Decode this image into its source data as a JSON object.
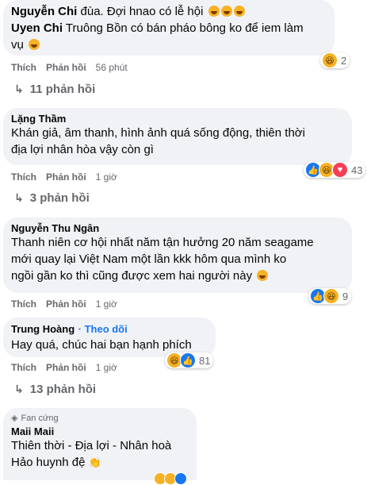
{
  "comments": [
    {
      "author": "Nguyễn Chi",
      "text": "đùa. Đợi hnao có lễ hội",
      "reply_author": "Uyen Chi",
      "reply_text_line1": "Truông Bồn có bán pháo bông ko để iem làm",
      "reply_text_line2": "vụ",
      "actions": {
        "like": "Thích",
        "reply": "Phản hồi",
        "time": "56 phút"
      },
      "reaction_count": "2",
      "replies_label": "11 phản hồi"
    },
    {
      "author": "Lặng Thầm",
      "text_line1": "Khán giả, âm thanh, hình ảnh quá sống động, thiên thời",
      "text_line2": "địa lợi nhân hòa vậy còn gì",
      "actions": {
        "like": "Thích",
        "reply": "Phản hồi",
        "time": "1 giờ"
      },
      "reaction_count": "43",
      "replies_label": "3 phản hồi"
    },
    {
      "author": "Nguyễn Thu Ngân",
      "text_line1": "Thanh niên cơ hội nhất năm tận hưởng 20 năm seagame",
      "text_line2": "mới quay lại Việt Nam một lần kkk hôm qua mình ko",
      "text_line3": "ngồi gần ko thì cũng được xem hai người này",
      "actions": {
        "like": "Thích",
        "reply": "Phản hồi",
        "time": "1 giờ"
      },
      "reaction_count": "9"
    },
    {
      "author": "Trung Hoàng",
      "follow": "Theo dõi",
      "text": "Hay quá, chúc hai bạn hạnh phích",
      "actions": {
        "like": "Thích",
        "reply": "Phản hồi",
        "time": "1 giờ"
      },
      "reaction_count": "81",
      "replies_label": "13 phản hồi"
    },
    {
      "badge": "Fan cứng",
      "author": "Maii Maii",
      "text_line1": "Thiên thời - Địa lợi - Nhân hoà",
      "text_line2": "Hảo huynh đệ"
    }
  ],
  "colors": {
    "bubble": "#f0f2f5",
    "meta": "#65676b",
    "like": "#1877f2",
    "link": "#1877f2"
  }
}
